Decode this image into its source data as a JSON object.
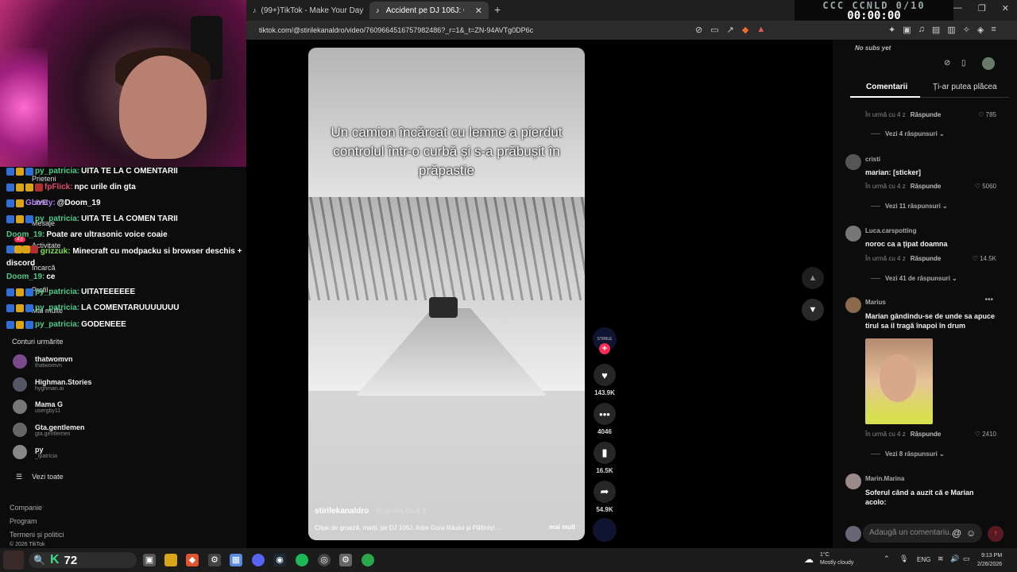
{
  "browser": {
    "tabs": [
      {
        "label": "(99+)TikTok - Make Your Day"
      },
      {
        "label": "Accident pe DJ 106J: Camion cu"
      }
    ],
    "url": "tiktok.com/@stirilekanaldro/video/7609664516757982486?_r=1&_t=ZN-94AVTg0DP6c"
  },
  "timer": {
    "top": "CCC CCNLD 0/10",
    "clock": "00:00:00"
  },
  "chat": [
    {
      "user": "py_patricia:",
      "msg": "UITA TE LA C OMENTARII",
      "color": "green"
    },
    {
      "user": "fpFlick:",
      "msg": "npc urile din gta",
      "color": "red"
    },
    {
      "user": "Ghosty:",
      "msg": "@Doom_19",
      "color": "purple"
    },
    {
      "user": "py_patricia:",
      "msg": "UITA TE LA COMEN TARII",
      "color": "green"
    },
    {
      "user": "Doom_19:",
      "msg": "Poate are ultrasonic voice coaie",
      "color": "green"
    },
    {
      "user": "grizzuk:",
      "msg": "Minecraft cu modpacku si browser deschis + discord",
      "color": "lime"
    },
    {
      "user": "Doom_19:",
      "msg": "ce",
      "color": "green"
    },
    {
      "user": "py_patricia:",
      "msg": "UITATEEEEEE",
      "color": "green"
    },
    {
      "user": "py_patricia:",
      "msg": "LA COMENTARUUUUUUU",
      "color": "green"
    },
    {
      "user": "py_patricia:",
      "msg": "GODENEEE",
      "color": "green"
    }
  ],
  "overlay_labels": {
    "friends": "Prieteni",
    "live": "LIVE",
    "messages": "Mesaje",
    "activity": "Activitate",
    "activity_count": "43",
    "upload": "Încarcă",
    "profile": "Profil",
    "more": "Mai multe"
  },
  "following": {
    "title": "Conturi urmărite",
    "accounts": [
      {
        "name": "thatwomvn",
        "handle": "thatwomvn"
      },
      {
        "name": "Highman.Stories",
        "handle": "hyghman.ai"
      },
      {
        "name": "Mama G",
        "handle": "usergby11"
      },
      {
        "name": "Gta.gentlemen",
        "handle": "gta.gentlemen"
      },
      {
        "name": "py",
        "handle": "_lpatricia"
      }
    ],
    "see_all": "Vezi toate"
  },
  "footer": {
    "company": "Companie",
    "program": "Program",
    "terms": "Termeni și politici",
    "copyright": "© 2026 TikTok"
  },
  "video": {
    "caption": "Un camion încărcat cu lemne a pierdut controlul într-o curbă și s-a prăbușit în prăpastie",
    "author": "stirilekanaldro",
    "time": " · În urmă cu 4 z",
    "description": "Clipe de groază, marți, pe DJ 106J, între Gura Râului și Păltiniș!...",
    "more": "mai mult",
    "likes": "143.9K",
    "comments": "4046",
    "saves": "16.5K",
    "shares": "54.9K"
  },
  "comments_panel": {
    "no_subs": "No subs yet",
    "tab_comments": "Comentarii",
    "tab_like": "Ți-ar putea plăcea",
    "items": [
      {
        "user": "",
        "text": "",
        "meta": "În urmă cu 4 z",
        "reply": "Răspunde",
        "likes": "785",
        "replies": "Vezi 4 răspunsuri"
      },
      {
        "user": "cristi",
        "text": "marian: [sticker]",
        "meta": "În urmă cu 4 z",
        "reply": "Răspunde",
        "likes": "5060",
        "replies": "Vezi 11 răspunsuri"
      },
      {
        "user": "Luca.carspotting",
        "text": "noroc ca a țipat doamna",
        "meta": "În urmă cu 4 z",
        "reply": "Răspunde",
        "likes": "14.5K",
        "replies": "Vezi 41 de răspunsuri"
      },
      {
        "user": "Marius",
        "text": "Marian gândindu-se de unde sa apuce tirul sa il tragă înapoi în drum",
        "meta": "În urmă cu 4 z",
        "reply": "Răspunde",
        "likes": "2410",
        "replies": "Vezi 8 răspunsuri"
      },
      {
        "user": "Marin.Marina",
        "text": "Soferul când a auzit că e Marian acolo:",
        "meta": "",
        "reply": "",
        "likes": "",
        "replies": ""
      }
    ],
    "add_placeholder": "Adaugă un comentariu..."
  },
  "taskbar": {
    "k_value": "72",
    "temp": "1°C",
    "weather": "Mostly cloudy",
    "lang": "ENG",
    "time": "9:13 PM",
    "date": "2/26/2026"
  }
}
